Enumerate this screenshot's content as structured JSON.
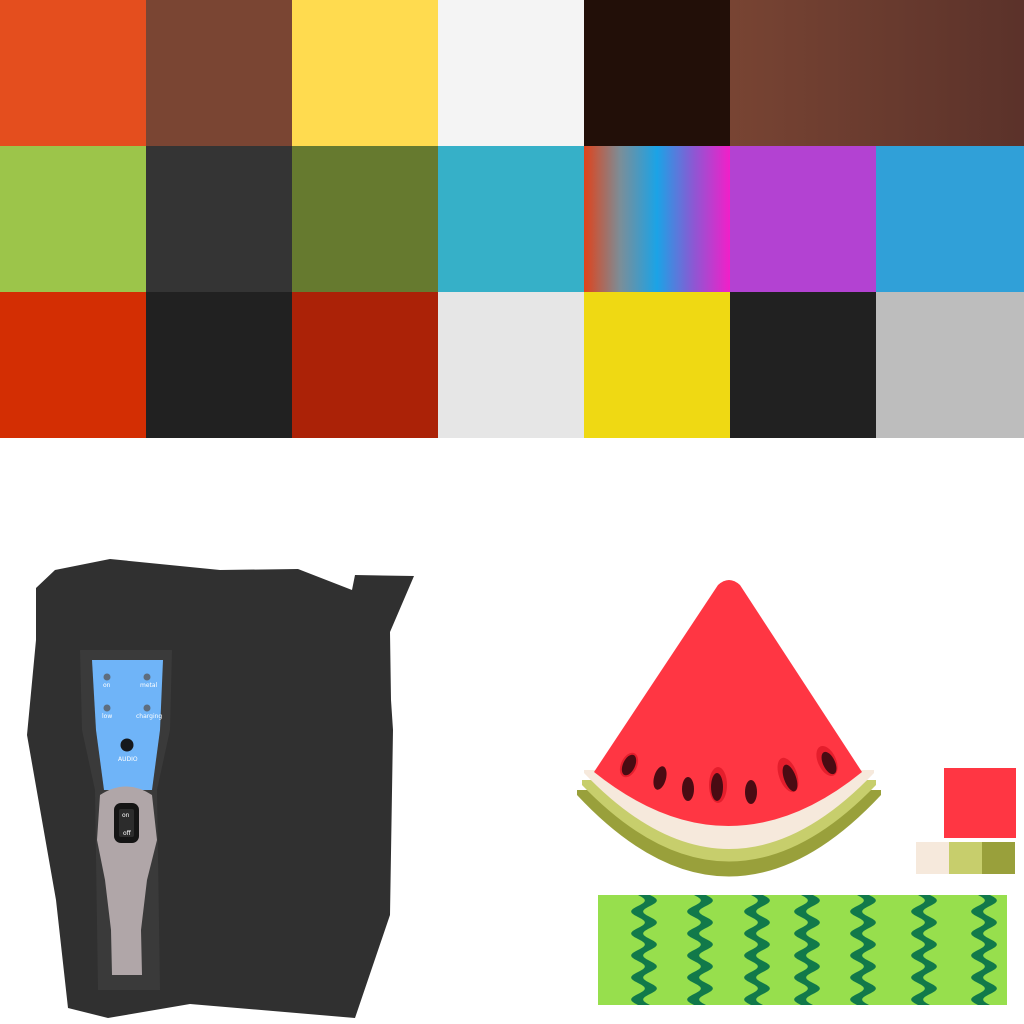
{
  "palette": {
    "rows": [
      [
        {
          "color": "#E44E1E"
        },
        {
          "color": "#7A4533"
        },
        {
          "color": "#FFDB4F"
        },
        {
          "color": "#F4F4F4"
        },
        {
          "color": "#220F08"
        },
        {
          "gradient": [
            "#784433",
            "#5B322A"
          ],
          "span": 2
        }
      ],
      [
        {
          "color": "#9CC54A"
        },
        {
          "color": "#343434"
        },
        {
          "color": "#667A2F"
        },
        {
          "color": "#36B0C8"
        },
        {
          "gradient": [
            "#E0431B",
            "#7A8E99",
            "#1BA3E6",
            "#8C58D3",
            "#F21FC8"
          ]
        },
        {
          "color": "#B342D2"
        },
        {
          "color": "#30A0D8"
        }
      ],
      [
        {
          "color": "#D32E03"
        },
        {
          "color": "#212121"
        },
        {
          "color": "#AB2207"
        },
        {
          "color": "#E6E6E6"
        },
        {
          "color": "#EFD913"
        },
        {
          "color": "#212121"
        },
        {
          "color": "#BDBDBD"
        }
      ]
    ]
  },
  "device": {
    "labels": {
      "on": "on",
      "metal": "metal",
      "low": "low",
      "charging": "charging",
      "audio": "AUDIO",
      "switch_on": "on",
      "switch_off": "off"
    },
    "colors": {
      "body": "#303030",
      "panel": "#6FB4F8",
      "handle": "#B0A6A8"
    }
  },
  "watermelon": {
    "colors": {
      "flesh": "#FF3643",
      "rind_inner": "#F6E9DC",
      "rind_mid": "#C7CE6C",
      "rind_outer": "#99A03B",
      "seed": "#4A0B13",
      "skin": "#97DF4D",
      "stripe": "#11794A"
    },
    "swatches": [
      "#FF3643",
      "#F6E9DC",
      "#C7CE6C",
      "#99A03B"
    ]
  }
}
